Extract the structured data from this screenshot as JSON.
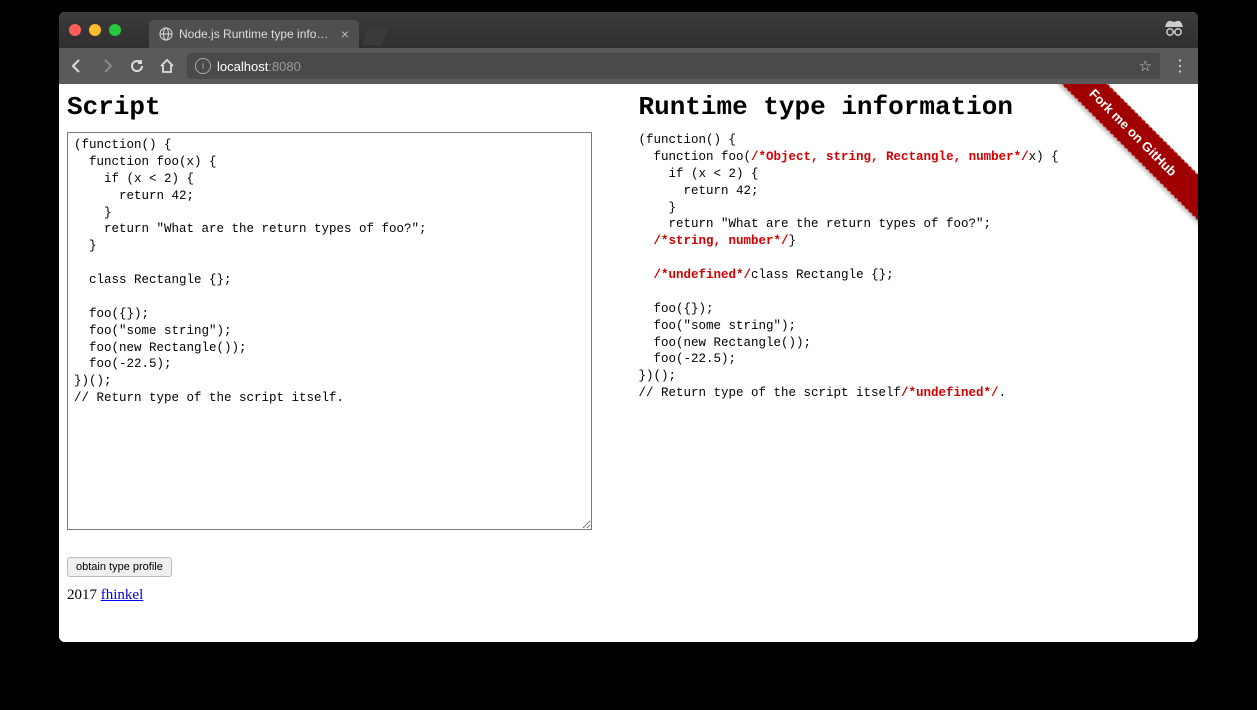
{
  "browser": {
    "tab_title": "Node.js Runtime type informat",
    "url_host": "localhost",
    "url_port": ":8080"
  },
  "page": {
    "left_heading": "Script",
    "right_heading": "Runtime type information",
    "script_text": "(function() {\n  function foo(x) {\n    if (x < 2) {\n      return 42;\n    }\n    return \"What are the return types of foo?\";\n  }\n\n  class Rectangle {};\n\n  foo({});\n  foo(\"some string\");\n  foo(new Rectangle());\n  foo(-22.5);\n})();\n// Return type of the script itself.",
    "output_segments": [
      {
        "t": "(function() {\n  function foo("
      },
      {
        "t": "/*Object, string, Rectangle, number*/",
        "ann": true
      },
      {
        "t": "x) {\n    if (x < 2) {\n      return 42;\n    }\n    return \"What are the return types of foo?\";\n  "
      },
      {
        "t": "/*string, number*/",
        "ann": true
      },
      {
        "t": "}\n\n  "
      },
      {
        "t": "/*undefined*/",
        "ann": true
      },
      {
        "t": "class Rectangle {};\n\n  foo({});\n  foo(\"some string\");\n  foo(new Rectangle());\n  foo(-22.5);\n})();\n// Return type of the script itself"
      },
      {
        "t": "/*undefined*/",
        "ann": true
      },
      {
        "t": "."
      }
    ],
    "button_label": "obtain type profile",
    "footer_year": "2017 ",
    "footer_link_text": "fhinkel",
    "ribbon_text": "Fork me on GitHub"
  }
}
